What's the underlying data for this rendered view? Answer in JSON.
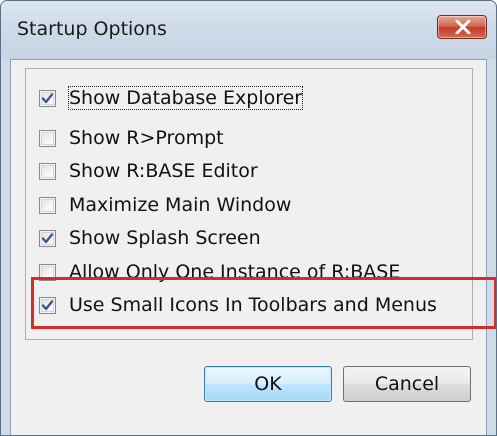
{
  "window": {
    "title": "Startup Options",
    "close_label": "close"
  },
  "options": [
    {
      "label": "Show Database Explorer",
      "checked": true
    },
    {
      "label": "Show R>Prompt",
      "checked": false
    },
    {
      "label": "Show R:BASE Editor",
      "checked": false
    },
    {
      "label": "Maximize Main Window",
      "checked": false
    },
    {
      "label": "Show Splash Screen",
      "checked": true
    },
    {
      "label": "Allow Only One Instance of R:BASE",
      "checked": false
    },
    {
      "label": "Use Small Icons In Toolbars and Menus",
      "checked": true
    }
  ],
  "buttons": {
    "ok": "OK",
    "cancel": "Cancel"
  },
  "colors": {
    "highlight": "#d62b2b",
    "checkmark": "#3a5a8c"
  }
}
